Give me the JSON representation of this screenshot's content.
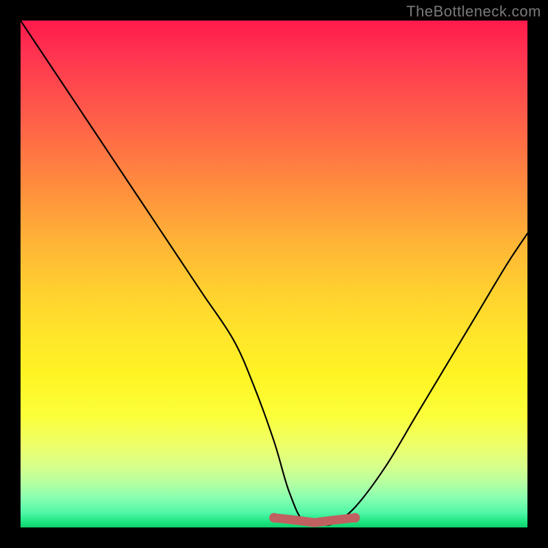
{
  "watermark": "TheBottleneck.com",
  "chart_data": {
    "type": "line",
    "title": "",
    "xlabel": "",
    "ylabel": "",
    "xlim": [
      0,
      100
    ],
    "ylim": [
      0,
      100
    ],
    "series": [
      {
        "name": "black-curve",
        "x": [
          0,
          6,
          12,
          18,
          24,
          30,
          36,
          42,
          46,
          50,
          53,
          56,
          60,
          62,
          66,
          72,
          78,
          84,
          90,
          96,
          100
        ],
        "values": [
          100,
          91,
          82,
          73,
          64,
          55,
          46,
          37,
          28,
          17,
          7,
          1,
          0.5,
          1,
          4,
          12,
          22,
          32,
          42,
          52,
          58
        ]
      }
    ],
    "highlight_band": {
      "x_start": 50,
      "x_end": 66,
      "y_level": 1.5,
      "color": "#c16060"
    },
    "background_gradient": {
      "top": "#ff1a4b",
      "mid": "#ffe52a",
      "bottom": "#0fce6a"
    }
  }
}
